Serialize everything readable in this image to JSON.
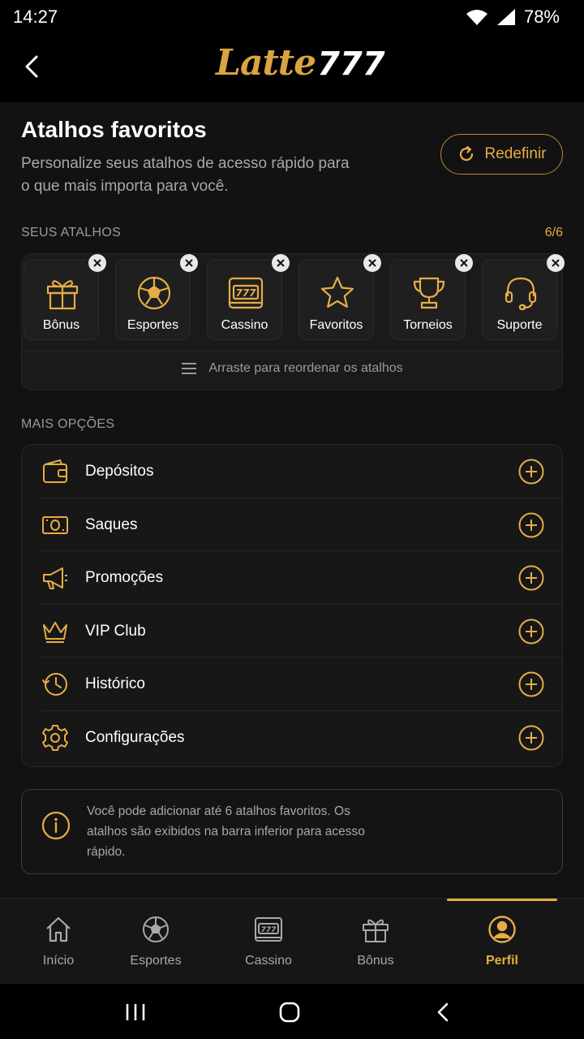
{
  "status": {
    "time": "14:27",
    "battery": "78%"
  },
  "header": {
    "logo_script": "Latte",
    "logo_number": "777",
    "back_icon": "chevron-left-icon"
  },
  "page": {
    "title": "Atalhos favoritos",
    "subtitle": "Personalize seus atalhos de acesso rápido para o que mais importa para você.",
    "reset_label": "Redefinir"
  },
  "shortcuts": {
    "section_label": "SEUS ATALHOS",
    "count": "6/6",
    "items": [
      {
        "label": "Bônus",
        "icon": "gift-icon"
      },
      {
        "label": "Esportes",
        "icon": "soccer-ball-icon"
      },
      {
        "label": "Cassino",
        "icon": "slot-machine-icon"
      },
      {
        "label": "Favoritos",
        "icon": "star-icon"
      },
      {
        "label": "Torneios",
        "icon": "trophy-icon"
      },
      {
        "label": "Suporte",
        "icon": "headset-icon"
      }
    ],
    "hint": "Arraste para reordenar os atalhos"
  },
  "more_options": {
    "section_label": "MAIS OPÇÕES",
    "items": [
      {
        "label": "Depósitos",
        "icon": "wallet-icon"
      },
      {
        "label": "Saques",
        "icon": "cash-icon"
      },
      {
        "label": "Promoções",
        "icon": "megaphone-icon"
      },
      {
        "label": "VIP Club",
        "icon": "crown-icon"
      },
      {
        "label": "Histórico",
        "icon": "clock-history-icon"
      },
      {
        "label": "Configurações",
        "icon": "gear-icon"
      }
    ]
  },
  "info": {
    "text": "Você pode adicionar até 6 atalhos favoritos. Os atalhos são exibidos na barra inferior para acesso rápido."
  },
  "bottom_nav": {
    "active": "Perfil",
    "items": [
      {
        "label": "Início",
        "icon": "home-icon"
      },
      {
        "label": "Esportes",
        "icon": "soccer-ball-icon"
      },
      {
        "label": "Cassino",
        "icon": "slot-machine-icon"
      },
      {
        "label": "Bônus",
        "icon": "gift-icon"
      },
      {
        "label": "Perfil",
        "icon": "user-circle-icon"
      }
    ]
  },
  "colors": {
    "accent": "#e6ad45",
    "background": "#121212",
    "surface": "#1a1a1a"
  }
}
